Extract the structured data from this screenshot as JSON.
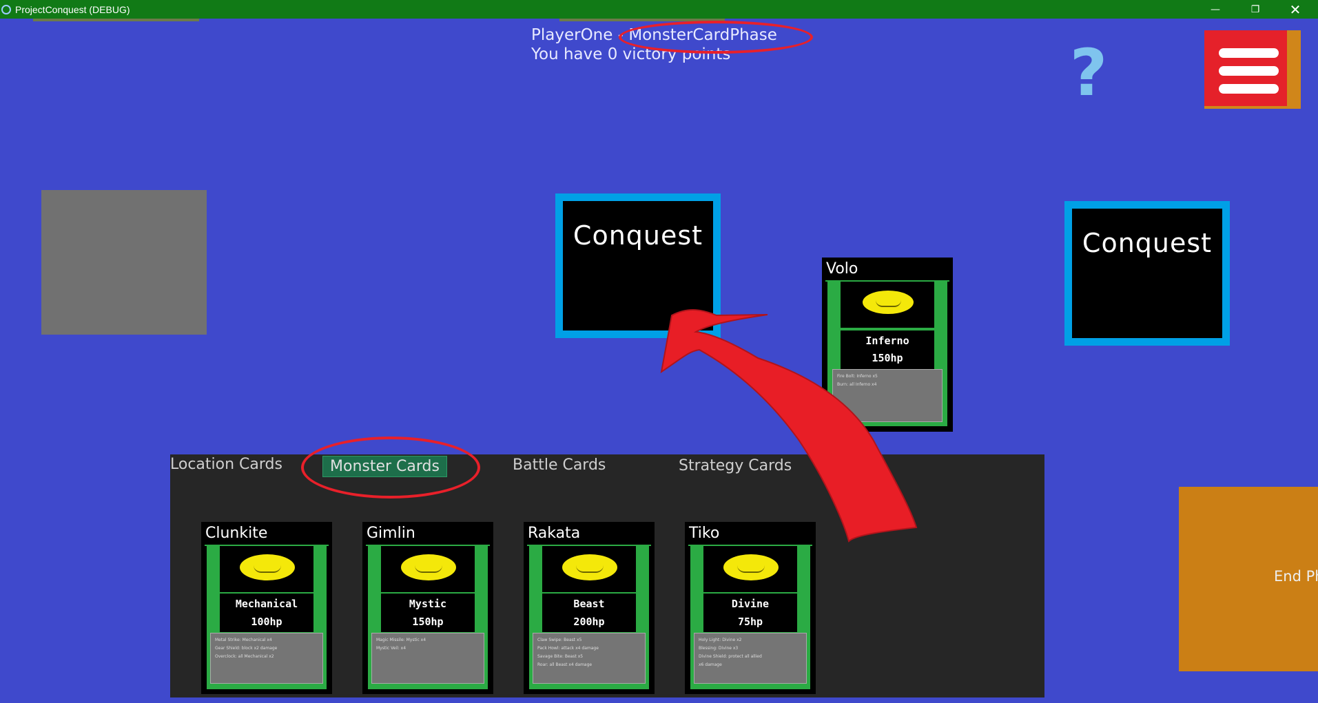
{
  "window": {
    "title": "ProjectConquest (DEBUG)",
    "controls": [
      "minimize-icon",
      "restore-icon",
      "close-icon"
    ]
  },
  "header": {
    "status": "PlayerOne - MonsterCardPhase",
    "victory": "You have 0 victory points"
  },
  "help": {
    "label": "?"
  },
  "menu": {
    "icon": "hamburger-icon"
  },
  "board": {
    "conquest_cards": [
      {
        "label": "Conquest"
      },
      {
        "label": "Conquest"
      }
    ],
    "played_card": {
      "name": "Volo",
      "type": "Inferno",
      "hp": "150hp",
      "desc": [
        "Fire Bolt: Inferno x5",
        "Burn: all Inferno x4"
      ]
    }
  },
  "hand": {
    "tabs": [
      "Location Cards",
      "Monster Cards",
      "Battle Cards",
      "Strategy Cards"
    ],
    "active_tab": "Monster Cards",
    "cards": [
      {
        "name": "Clunkite",
        "type": "Mechanical",
        "hp": "100hp",
        "desc": [
          "Metal Strike: Mechanical x4",
          "Gear Shield: block x2 damage",
          "Overclock: all Mechanical x2"
        ]
      },
      {
        "name": "Gimlin",
        "type": "Mystic",
        "hp": "150hp",
        "desc": [
          "Magic Missile: Mystic x4",
          "Mystic Veil: x4"
        ]
      },
      {
        "name": "Rakata",
        "type": "Beast",
        "hp": "200hp",
        "desc": [
          "Claw Swipe: Beast x5",
          "Pack Howl: attack x4 damage",
          "Savage Bite: Beast x5",
          "Roar: all Beast x4 damage"
        ]
      },
      {
        "name": "Tiko",
        "type": "Divine",
        "hp": "75hp",
        "desc": [
          "Holy Light: Divine x2",
          "Blessing: Divine x3",
          "Divine Shield: protect all allied",
          "x6 damage"
        ]
      }
    ]
  },
  "end_button": {
    "label": "End Phase"
  },
  "colors": {
    "background": "#3f49cc",
    "titlebar": "#117a16",
    "conquest_border": "#00a0e6",
    "card_green": "#2bab44",
    "annotation_red": "#e8202a",
    "end_button": "#cb7f15",
    "menu_button": "#e5212a"
  }
}
